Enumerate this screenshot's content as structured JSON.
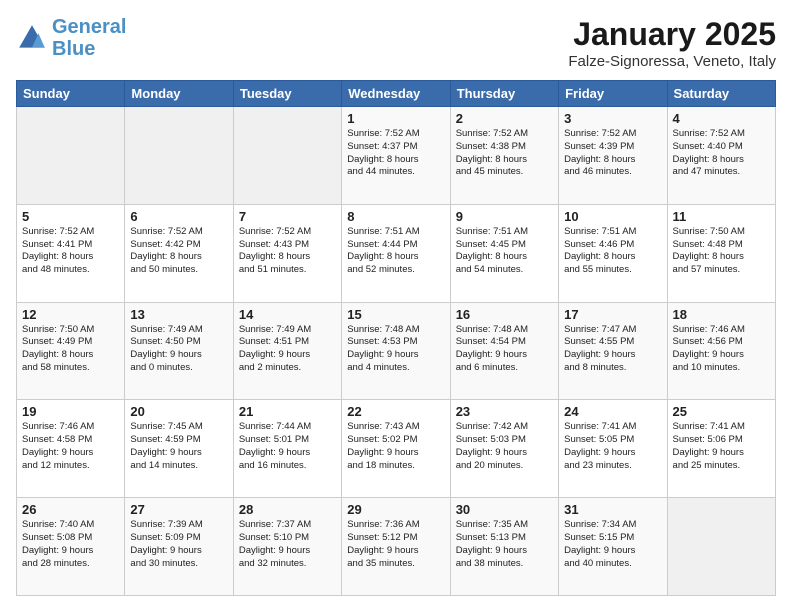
{
  "header": {
    "logo_line1": "General",
    "logo_line2": "Blue",
    "month": "January 2025",
    "location": "Falze-Signoressa, Veneto, Italy"
  },
  "weekdays": [
    "Sunday",
    "Monday",
    "Tuesday",
    "Wednesday",
    "Thursday",
    "Friday",
    "Saturday"
  ],
  "weeks": [
    [
      {
        "day": "",
        "info": ""
      },
      {
        "day": "",
        "info": ""
      },
      {
        "day": "",
        "info": ""
      },
      {
        "day": "1",
        "info": "Sunrise: 7:52 AM\nSunset: 4:37 PM\nDaylight: 8 hours\nand 44 minutes."
      },
      {
        "day": "2",
        "info": "Sunrise: 7:52 AM\nSunset: 4:38 PM\nDaylight: 8 hours\nand 45 minutes."
      },
      {
        "day": "3",
        "info": "Sunrise: 7:52 AM\nSunset: 4:39 PM\nDaylight: 8 hours\nand 46 minutes."
      },
      {
        "day": "4",
        "info": "Sunrise: 7:52 AM\nSunset: 4:40 PM\nDaylight: 8 hours\nand 47 minutes."
      }
    ],
    [
      {
        "day": "5",
        "info": "Sunrise: 7:52 AM\nSunset: 4:41 PM\nDaylight: 8 hours\nand 48 minutes."
      },
      {
        "day": "6",
        "info": "Sunrise: 7:52 AM\nSunset: 4:42 PM\nDaylight: 8 hours\nand 50 minutes."
      },
      {
        "day": "7",
        "info": "Sunrise: 7:52 AM\nSunset: 4:43 PM\nDaylight: 8 hours\nand 51 minutes."
      },
      {
        "day": "8",
        "info": "Sunrise: 7:51 AM\nSunset: 4:44 PM\nDaylight: 8 hours\nand 52 minutes."
      },
      {
        "day": "9",
        "info": "Sunrise: 7:51 AM\nSunset: 4:45 PM\nDaylight: 8 hours\nand 54 minutes."
      },
      {
        "day": "10",
        "info": "Sunrise: 7:51 AM\nSunset: 4:46 PM\nDaylight: 8 hours\nand 55 minutes."
      },
      {
        "day": "11",
        "info": "Sunrise: 7:50 AM\nSunset: 4:48 PM\nDaylight: 8 hours\nand 57 minutes."
      }
    ],
    [
      {
        "day": "12",
        "info": "Sunrise: 7:50 AM\nSunset: 4:49 PM\nDaylight: 8 hours\nand 58 minutes."
      },
      {
        "day": "13",
        "info": "Sunrise: 7:49 AM\nSunset: 4:50 PM\nDaylight: 9 hours\nand 0 minutes."
      },
      {
        "day": "14",
        "info": "Sunrise: 7:49 AM\nSunset: 4:51 PM\nDaylight: 9 hours\nand 2 minutes."
      },
      {
        "day": "15",
        "info": "Sunrise: 7:48 AM\nSunset: 4:53 PM\nDaylight: 9 hours\nand 4 minutes."
      },
      {
        "day": "16",
        "info": "Sunrise: 7:48 AM\nSunset: 4:54 PM\nDaylight: 9 hours\nand 6 minutes."
      },
      {
        "day": "17",
        "info": "Sunrise: 7:47 AM\nSunset: 4:55 PM\nDaylight: 9 hours\nand 8 minutes."
      },
      {
        "day": "18",
        "info": "Sunrise: 7:46 AM\nSunset: 4:56 PM\nDaylight: 9 hours\nand 10 minutes."
      }
    ],
    [
      {
        "day": "19",
        "info": "Sunrise: 7:46 AM\nSunset: 4:58 PM\nDaylight: 9 hours\nand 12 minutes."
      },
      {
        "day": "20",
        "info": "Sunrise: 7:45 AM\nSunset: 4:59 PM\nDaylight: 9 hours\nand 14 minutes."
      },
      {
        "day": "21",
        "info": "Sunrise: 7:44 AM\nSunset: 5:01 PM\nDaylight: 9 hours\nand 16 minutes."
      },
      {
        "day": "22",
        "info": "Sunrise: 7:43 AM\nSunset: 5:02 PM\nDaylight: 9 hours\nand 18 minutes."
      },
      {
        "day": "23",
        "info": "Sunrise: 7:42 AM\nSunset: 5:03 PM\nDaylight: 9 hours\nand 20 minutes."
      },
      {
        "day": "24",
        "info": "Sunrise: 7:41 AM\nSunset: 5:05 PM\nDaylight: 9 hours\nand 23 minutes."
      },
      {
        "day": "25",
        "info": "Sunrise: 7:41 AM\nSunset: 5:06 PM\nDaylight: 9 hours\nand 25 minutes."
      }
    ],
    [
      {
        "day": "26",
        "info": "Sunrise: 7:40 AM\nSunset: 5:08 PM\nDaylight: 9 hours\nand 28 minutes."
      },
      {
        "day": "27",
        "info": "Sunrise: 7:39 AM\nSunset: 5:09 PM\nDaylight: 9 hours\nand 30 minutes."
      },
      {
        "day": "28",
        "info": "Sunrise: 7:37 AM\nSunset: 5:10 PM\nDaylight: 9 hours\nand 32 minutes."
      },
      {
        "day": "29",
        "info": "Sunrise: 7:36 AM\nSunset: 5:12 PM\nDaylight: 9 hours\nand 35 minutes."
      },
      {
        "day": "30",
        "info": "Sunrise: 7:35 AM\nSunset: 5:13 PM\nDaylight: 9 hours\nand 38 minutes."
      },
      {
        "day": "31",
        "info": "Sunrise: 7:34 AM\nSunset: 5:15 PM\nDaylight: 9 hours\nand 40 minutes."
      },
      {
        "day": "",
        "info": ""
      }
    ]
  ]
}
